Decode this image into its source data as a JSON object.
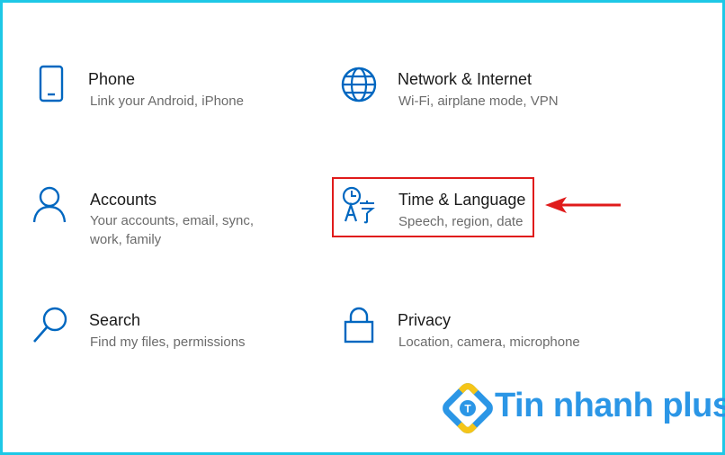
{
  "tiles": [
    {
      "icon": "phone-icon",
      "title": "Phone",
      "desc": "Link your Android, iPhone"
    },
    {
      "icon": "globe-icon",
      "title": "Network & Internet",
      "desc": "Wi-Fi, airplane mode, VPN"
    },
    {
      "icon": "person-icon",
      "title": "Accounts",
      "desc": "Your accounts, email, sync, work, family"
    },
    {
      "icon": "time-language-icon",
      "title": "Time & Language",
      "desc": "Speech, region, date"
    },
    {
      "icon": "search-icon",
      "title": "Search",
      "desc": "Find my files, permissions"
    },
    {
      "icon": "lock-icon",
      "title": "Privacy",
      "desc": "Location, camera, microphone"
    }
  ],
  "annotation": {
    "highlight_color": "#e01b1b",
    "arrow_color": "#e01b1b"
  },
  "watermark": {
    "text": "Tin nhanh plus",
    "logo_letter": "T",
    "color": "#2b96e6"
  },
  "accent": "#0067c0"
}
